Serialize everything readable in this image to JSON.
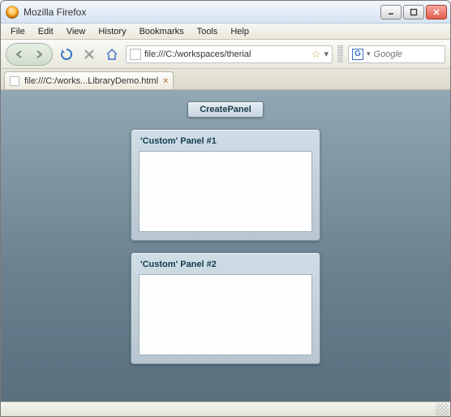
{
  "window": {
    "title": "Mozilla Firefox"
  },
  "menu": {
    "items": [
      "File",
      "Edit",
      "View",
      "History",
      "Bookmarks",
      "Tools",
      "Help"
    ]
  },
  "toolbar": {
    "address_value": "file:///C:/workspaces/therial",
    "search_placeholder": "Google"
  },
  "tabs": [
    {
      "label": "file:///C:/works...LibraryDemo.html"
    }
  ],
  "page": {
    "create_label": "CreatePanel",
    "panels": [
      {
        "title": "'Custom' Panel #1"
      },
      {
        "title": "'Custom' Panel #2"
      }
    ]
  }
}
